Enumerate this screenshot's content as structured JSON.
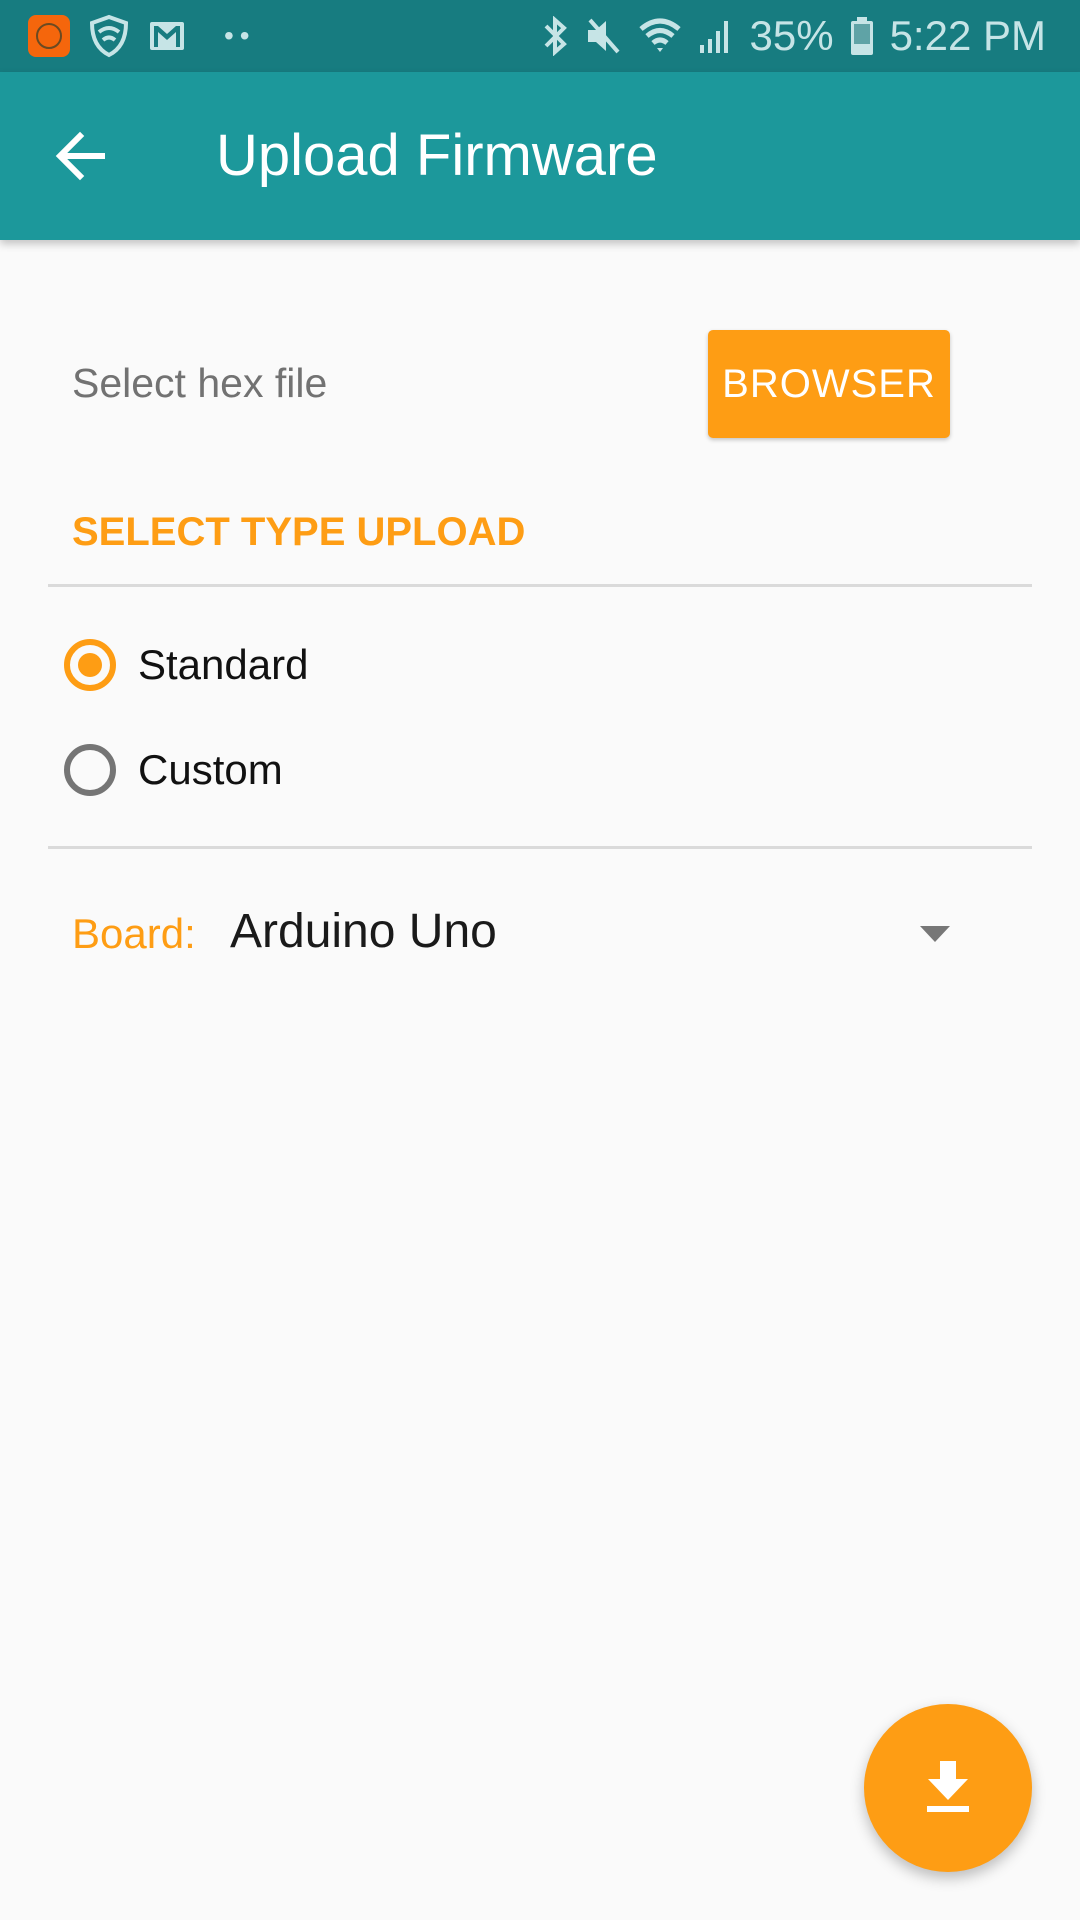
{
  "status_bar": {
    "left_icons": [
      "mi-app-icon",
      "shield-wifi-icon",
      "gmail-icon",
      "more-notifications-dots"
    ],
    "right_icons": [
      "bluetooth-icon",
      "mute-icon",
      "wifi-icon",
      "signal-icon"
    ],
    "battery_percent": "35%",
    "time": "5:22 PM"
  },
  "app_bar": {
    "back_icon": "arrow-left-icon",
    "title": "Upload Firmware"
  },
  "file_select": {
    "label": "Select hex file",
    "button_label": "BROWSER"
  },
  "upload_type": {
    "section_title": "SELECT TYPE UPLOAD",
    "options": [
      {
        "label": "Standard",
        "selected": true
      },
      {
        "label": "Custom",
        "selected": false
      }
    ]
  },
  "board": {
    "label": "Board:",
    "selected": "Arduino Uno"
  },
  "fab": {
    "icon": "download-icon"
  },
  "colors": {
    "status_bar": "#177c80",
    "app_bar": "#1c989b",
    "accent": "#fe9d14",
    "background": "#fafafa"
  }
}
